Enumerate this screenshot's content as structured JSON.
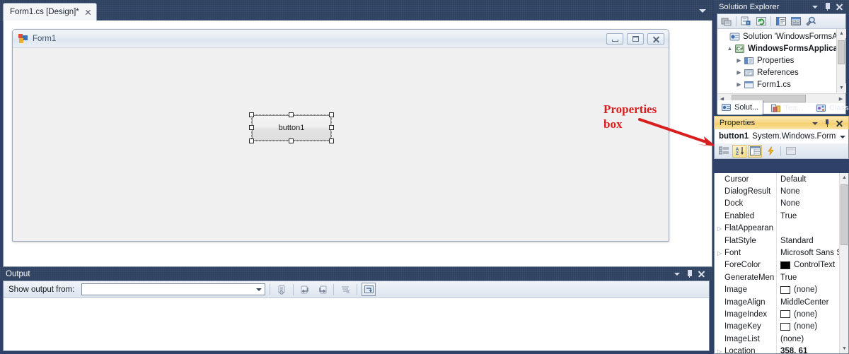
{
  "app": {
    "theme_accent": "#2e4160",
    "annotation_color": "#d81e1e"
  },
  "document_tabs": [
    {
      "label": "Form1.cs [Design]*",
      "active": true,
      "close_icon": "close-icon"
    }
  ],
  "designer": {
    "form": {
      "title": "Form1",
      "icon": "form-designer-icon",
      "window_buttons": [
        {
          "name": "minimize-button",
          "glyph": "minimize-icon"
        },
        {
          "name": "maximize-button",
          "glyph": "maximize-icon"
        },
        {
          "name": "close-button",
          "glyph": "close-icon"
        }
      ],
      "controls": [
        {
          "type": "button",
          "text": "button1",
          "selected": true,
          "handles": 8
        }
      ]
    }
  },
  "annotation": {
    "line1": "Properties",
    "line2": "box",
    "arrow": "red-arrow-icon"
  },
  "solution_explorer": {
    "title": "Solution Explorer",
    "title_buttons": [
      {
        "name": "window-dropdown-icon",
        "glyph": "caret-down"
      },
      {
        "name": "pin-icon",
        "glyph": "pin"
      },
      {
        "name": "close-icon",
        "glyph": "x"
      }
    ],
    "toolbar": [
      {
        "name": "properties-window-button",
        "icon": "properties-window-icon"
      },
      {
        "name": "show-all-files-button",
        "icon": "show-all-files-icon"
      },
      {
        "name": "refresh-button",
        "icon": "refresh-icon"
      },
      {
        "name": "view-code-button",
        "icon": "view-code-icon"
      },
      {
        "name": "view-designer-button",
        "icon": "view-designer-icon"
      },
      {
        "name": "preview-selected-items-button",
        "icon": "magnifier-icon"
      }
    ],
    "tree": [
      {
        "label": "Solution 'WindowsFormsApp",
        "indent": 0,
        "expander": "",
        "icon": "solution-icon",
        "bold": false
      },
      {
        "label": "WindowsFormsApplicatio",
        "indent": 1,
        "expander": "collapse",
        "icon": "csharp-project-icon",
        "bold": true
      },
      {
        "label": "Properties",
        "indent": 2,
        "expander": "expand",
        "icon": "properties-folder-icon",
        "bold": false
      },
      {
        "label": "References",
        "indent": 2,
        "expander": "expand",
        "icon": "references-icon",
        "bold": false
      },
      {
        "label": "Form1.cs",
        "indent": 2,
        "expander": "expand",
        "icon": "form-file-icon",
        "bold": false
      }
    ],
    "tabs": [
      {
        "label": "Solut...",
        "icon": "solution-explorer-icon",
        "active": true
      },
      {
        "label": "Tea...",
        "icon": "team-explorer-icon",
        "active": false
      },
      {
        "label": "Class...",
        "icon": "class-view-icon",
        "active": false
      }
    ]
  },
  "properties": {
    "title": "Properties",
    "title_buttons": [
      {
        "name": "window-dropdown-icon",
        "glyph": "caret-down"
      },
      {
        "name": "pin-icon",
        "glyph": "pin"
      },
      {
        "name": "close-icon",
        "glyph": "x"
      }
    ],
    "object_name": "button1",
    "object_type": "System.Windows.Forms.B",
    "toolbar": [
      {
        "name": "categorized-button",
        "icon": "categorized-icon",
        "active": false
      },
      {
        "name": "alphabetical-button",
        "icon": "alphabetical-sort-icon",
        "active": true
      },
      {
        "name": "properties-button",
        "icon": "properties-page-icon",
        "active": true
      },
      {
        "name": "events-button",
        "icon": "lightning-icon",
        "active": false
      },
      {
        "name": "property-pages-button",
        "icon": "property-pages-icon",
        "active": false
      }
    ],
    "rows": [
      {
        "name": "Cursor",
        "value": "Default",
        "expander": false,
        "bold": false,
        "swatch": null
      },
      {
        "name": "DialogResult",
        "value": "None",
        "expander": false,
        "bold": false,
        "swatch": null
      },
      {
        "name": "Dock",
        "value": "None",
        "expander": false,
        "bold": false,
        "swatch": null
      },
      {
        "name": "Enabled",
        "value": "True",
        "expander": false,
        "bold": false,
        "swatch": null
      },
      {
        "name": "FlatAppearan",
        "value": "",
        "expander": true,
        "bold": false,
        "swatch": null
      },
      {
        "name": "FlatStyle",
        "value": "Standard",
        "expander": false,
        "bold": false,
        "swatch": null
      },
      {
        "name": "Font",
        "value": "Microsoft Sans S",
        "expander": true,
        "bold": false,
        "swatch": null
      },
      {
        "name": "ForeColor",
        "value": "ControlText",
        "expander": false,
        "bold": false,
        "swatch": "#000000"
      },
      {
        "name": "GenerateMen",
        "value": "True",
        "expander": false,
        "bold": false,
        "swatch": null
      },
      {
        "name": "Image",
        "value": "(none)",
        "expander": false,
        "bold": false,
        "swatch": "#ffffff"
      },
      {
        "name": "ImageAlign",
        "value": "MiddleCenter",
        "expander": false,
        "bold": false,
        "swatch": null
      },
      {
        "name": "ImageIndex",
        "value": "(none)",
        "expander": false,
        "bold": false,
        "swatch": "#ffffff"
      },
      {
        "name": "ImageKey",
        "value": "(none)",
        "expander": false,
        "bold": false,
        "swatch": "#ffffff"
      },
      {
        "name": "ImageList",
        "value": "(none)",
        "expander": false,
        "bold": false,
        "swatch": null
      },
      {
        "name": "Location",
        "value": "358, 61",
        "expander": true,
        "bold": true,
        "swatch": null
      }
    ]
  },
  "output": {
    "title": "Output",
    "title_buttons": [
      {
        "name": "window-dropdown-icon",
        "glyph": "caret-down"
      },
      {
        "name": "pin-icon",
        "glyph": "pin"
      },
      {
        "name": "close-icon",
        "glyph": "x"
      }
    ],
    "show_output_from_label": "Show output from:",
    "combo_value": "",
    "toolbar": [
      {
        "name": "find-message-button",
        "icon": "find-message-icon"
      },
      {
        "name": "go-to-previous-message-button",
        "icon": "previous-message-icon"
      },
      {
        "name": "go-to-next-message-button",
        "icon": "next-message-icon"
      },
      {
        "name": "clear-all-button",
        "icon": "clear-all-icon"
      },
      {
        "name": "toggle-word-wrap-button",
        "icon": "word-wrap-icon"
      }
    ]
  }
}
